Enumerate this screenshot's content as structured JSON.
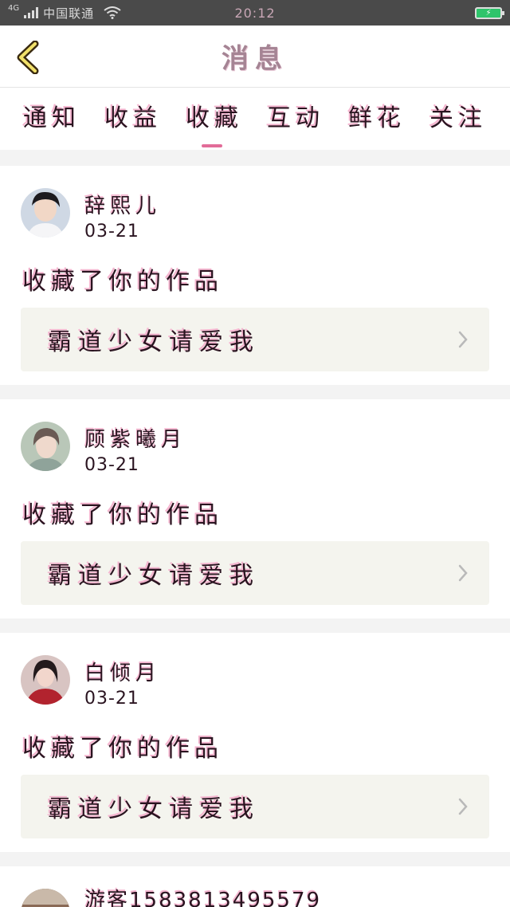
{
  "status_bar": {
    "network": "4G",
    "carrier": "中国联通",
    "time": "20:12",
    "battery_icon": "battery-charging-icon"
  },
  "header": {
    "title": "消息",
    "back_icon": "chevron-left-icon"
  },
  "tabs": [
    {
      "label": "通知",
      "active": false
    },
    {
      "label": "收益",
      "active": false
    },
    {
      "label": "收藏",
      "active": true
    },
    {
      "label": "互动",
      "active": false
    },
    {
      "label": "鲜花",
      "active": false
    },
    {
      "label": "关注",
      "active": false
    }
  ],
  "notifications": [
    {
      "user": "辞熙儿",
      "date": "03-21",
      "action": "收藏了你的作品",
      "work_title": "霸道少女请爱我"
    },
    {
      "user": "顾紫曦月",
      "date": "03-21",
      "action": "收藏了你的作品",
      "work_title": "霸道少女请爱我"
    },
    {
      "user": "白倾月",
      "date": "03-21",
      "action": "收藏了你的作品",
      "work_title": "霸道少女请爱我"
    },
    {
      "user": "游客15838134955​79"
    }
  ],
  "colors": {
    "accent": "#e26c98",
    "header_bg": "#ffffff",
    "status_bar_bg": "#4a4a4a",
    "work_link_bg": "#f4f4ee"
  }
}
